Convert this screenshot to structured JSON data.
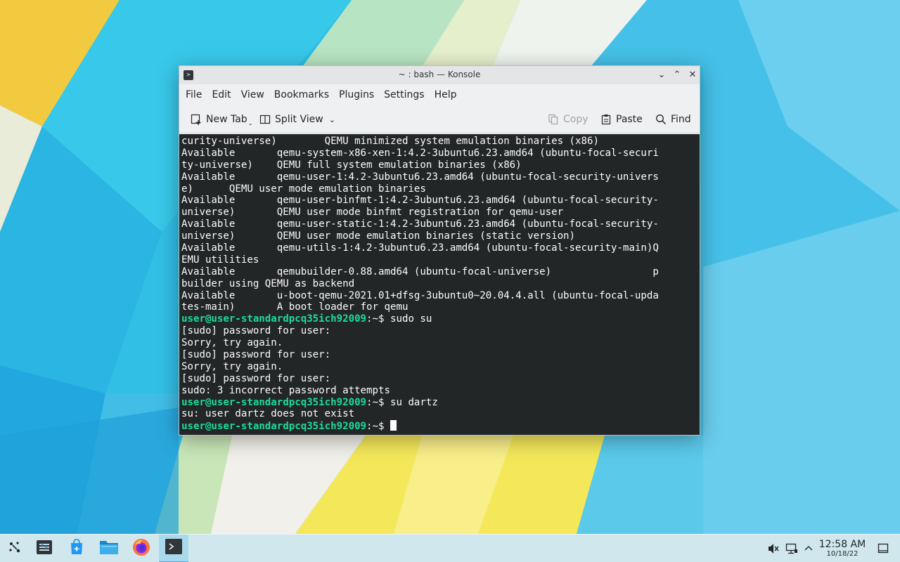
{
  "window": {
    "title": "~ : bash — Konsole",
    "app_icon_glyph": ">",
    "controls": {
      "minimize": "⌄",
      "maximize": "⌃",
      "close": "✕"
    }
  },
  "menu": [
    "File",
    "Edit",
    "View",
    "Bookmarks",
    "Plugins",
    "Settings",
    "Help"
  ],
  "toolbar": {
    "new_tab": "New Tab",
    "split_view": "Split View",
    "copy": "Copy",
    "paste": "Paste",
    "find": "Find"
  },
  "terminal": {
    "prompt": "user@user-standardpcq35ich92009",
    "lines": [
      {
        "text": "curity-universe)        QEMU minimized system emulation binaries (x86)"
      },
      {
        "text": "Available       qemu-system-x86-xen-1:4.2-3ubuntu6.23.amd64 (ubuntu-focal-securi"
      },
      {
        "text": "ty-universe)    QEMU full system emulation binaries (x86)"
      },
      {
        "text": "Available       qemu-user-1:4.2-3ubuntu6.23.amd64 (ubuntu-focal-security-univers"
      },
      {
        "text": "e)      QEMU user mode emulation binaries"
      },
      {
        "text": "Available       qemu-user-binfmt-1:4.2-3ubuntu6.23.amd64 (ubuntu-focal-security-"
      },
      {
        "text": "universe)       QEMU user mode binfmt registration for qemu-user"
      },
      {
        "text": "Available       qemu-user-static-1:4.2-3ubuntu6.23.amd64 (ubuntu-focal-security-"
      },
      {
        "text": "universe)       QEMU user mode emulation binaries (static version)"
      },
      {
        "text": "Available       qemu-utils-1:4.2-3ubuntu6.23.amd64 (ubuntu-focal-security-main)Q"
      },
      {
        "text": "EMU utilities"
      },
      {
        "text": "Available       qemubuilder-0.88.amd64 (ubuntu-focal-universe)                 p"
      },
      {
        "text": "builder using QEMU as backend"
      },
      {
        "text": "Available       u-boot-qemu-2021.01+dfsg-3ubuntu0~20.04.4.all (ubuntu-focal-upda"
      },
      {
        "text": "tes-main)       A boot loader for qemu"
      },
      {
        "cmd": "sudo su"
      },
      {
        "text": "[sudo] password for user:"
      },
      {
        "text": "Sorry, try again."
      },
      {
        "text": "[sudo] password for user:"
      },
      {
        "text": "Sorry, try again."
      },
      {
        "text": "[sudo] password for user:"
      },
      {
        "text": "sudo: 3 incorrect password attempts"
      },
      {
        "cmd": "su dartz"
      },
      {
        "text": "su: user dartz does not exist"
      },
      {
        "cmd": "",
        "cursor": true
      }
    ]
  },
  "taskbar": {
    "apps": [
      "application-launcher-icon",
      "pager-icon",
      "discover-icon",
      "dolphin-icon",
      "firefox-icon",
      "konsole-icon"
    ],
    "clock": {
      "time": "12:58 AM",
      "date": "10/18/22"
    }
  },
  "colors": {
    "prompt": "#1cdc9a",
    "terminal_bg": "#232627",
    "accent": "#3daee9"
  }
}
